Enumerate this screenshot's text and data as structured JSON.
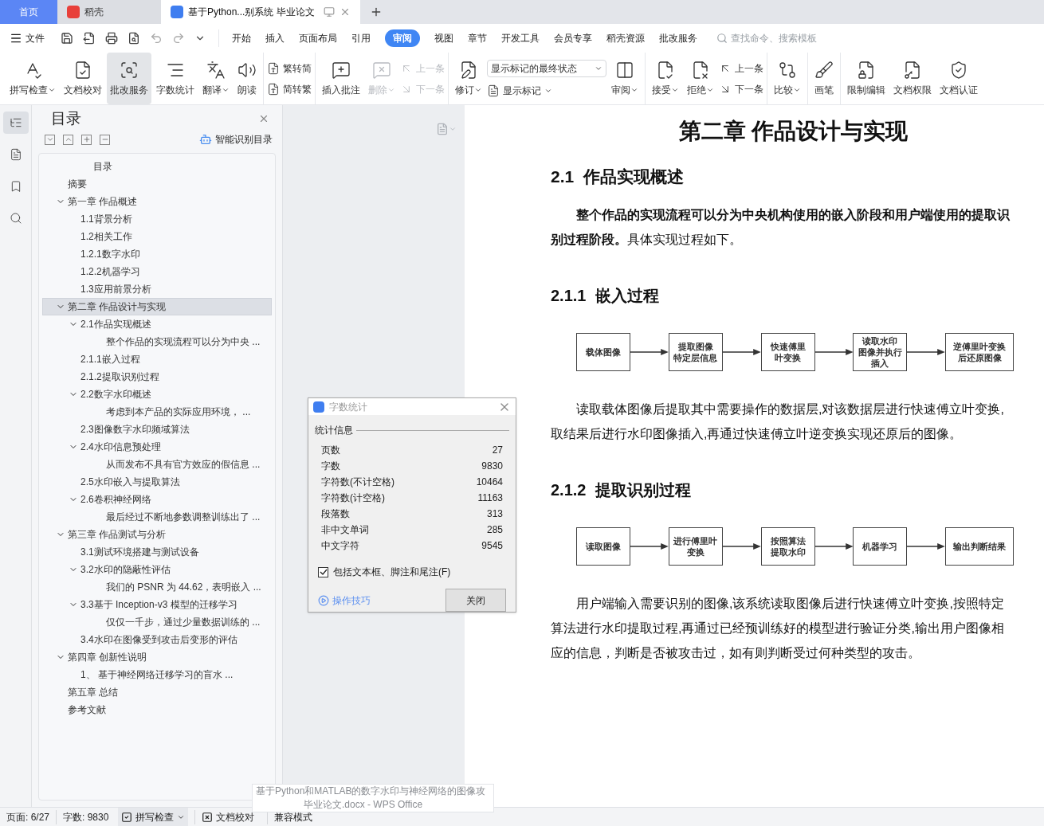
{
  "tabs": [
    {
      "label": "首页",
      "kind": "home",
      "selected": false
    },
    {
      "label": "稻壳",
      "kind": "app",
      "selected": false
    },
    {
      "label": "基于Python...别系统 毕业论文",
      "kind": "doc",
      "selected": true
    }
  ],
  "menu": {
    "file": "文件",
    "tabs": [
      {
        "label": "开始",
        "selected": false
      },
      {
        "label": "插入",
        "selected": false
      },
      {
        "label": "页面布局",
        "selected": false
      },
      {
        "label": "引用",
        "selected": false
      },
      {
        "label": "审阅",
        "selected": true
      },
      {
        "label": "视图",
        "selected": false
      },
      {
        "label": "章节",
        "selected": false
      },
      {
        "label": "开发工具",
        "selected": false
      },
      {
        "label": "会员专享",
        "selected": false
      },
      {
        "label": "稻壳资源",
        "selected": false
      },
      {
        "label": "批改服务",
        "selected": false
      }
    ],
    "search": {
      "placeholder": "查找命令、搜索模板"
    }
  },
  "ribbon": [
    {
      "items": [
        {
          "kind": "large",
          "label": "拼写检查",
          "dropdown": true,
          "disabled": false,
          "highlighted": false
        },
        {
          "kind": "large",
          "label": "文档校对",
          "dropdown": false,
          "disabled": false,
          "highlighted": false
        },
        {
          "kind": "large",
          "label": "批改服务",
          "dropdown": false,
          "disabled": false,
          "highlighted": true
        },
        {
          "kind": "large",
          "label": "字数统计",
          "dropdown": false,
          "disabled": false,
          "highlighted": false
        },
        {
          "kind": "large",
          "label": "翻译",
          "dropdown": true,
          "disabled": false,
          "highlighted": false
        },
        {
          "kind": "large",
          "label": "朗读",
          "dropdown": false,
          "disabled": false,
          "highlighted": false
        }
      ]
    },
    {
      "items": [
        {
          "kind": "stack",
          "items": [
            {
              "kind": "small",
              "label": "繁转简",
              "dropdown": false,
              "disabled": false
            },
            {
              "kind": "small",
              "label": "简转繁",
              "dropdown": false,
              "disabled": false
            }
          ]
        }
      ]
    },
    {
      "items": [
        {
          "kind": "large",
          "label": "插入批注",
          "dropdown": false,
          "disabled": false,
          "highlighted": false
        },
        {
          "kind": "large",
          "label": "删除",
          "dropdown": true,
          "disabled": true,
          "highlighted": false
        },
        {
          "kind": "stack",
          "items": [
            {
              "kind": "small",
              "label": "上一条",
              "dropdown": false,
              "disabled": true
            },
            {
              "kind": "small",
              "label": "下一条",
              "dropdown": false,
              "disabled": true
            }
          ]
        }
      ]
    },
    {
      "items": [
        {
          "kind": "large",
          "label": "修订",
          "dropdown": true,
          "disabled": false,
          "highlighted": false
        },
        {
          "kind": "stack",
          "items": [
            {
              "kind": "select",
              "value": "显示标记的最终状态"
            },
            {
              "kind": "small",
              "label": "显示标记",
              "dropdown": true,
              "disabled": false
            }
          ]
        },
        {
          "kind": "large",
          "label": "审阅",
          "dropdown": true,
          "disabled": false,
          "highlighted": false
        }
      ]
    },
    {
      "items": [
        {
          "kind": "large",
          "label": "接受",
          "dropdown": true,
          "disabled": false,
          "highlighted": false
        },
        {
          "kind": "large",
          "label": "拒绝",
          "dropdown": true,
          "disabled": false,
          "highlighted": false
        },
        {
          "kind": "stack",
          "items": [
            {
              "kind": "small",
              "label": "上一条",
              "dropdown": false,
              "disabled": false
            },
            {
              "kind": "small",
              "label": "下一条",
              "dropdown": false,
              "disabled": false
            }
          ]
        }
      ]
    },
    {
      "items": [
        {
          "kind": "large",
          "label": "比较",
          "dropdown": true,
          "disabled": false,
          "highlighted": false
        }
      ]
    },
    {
      "items": [
        {
          "kind": "large",
          "label": "画笔",
          "dropdown": false,
          "disabled": false,
          "highlighted": false
        }
      ]
    },
    {
      "items": [
        {
          "kind": "large",
          "label": "限制编辑",
          "dropdown": false,
          "disabled": false,
          "highlighted": false
        },
        {
          "kind": "large",
          "label": "文档权限",
          "dropdown": false,
          "disabled": false,
          "highlighted": false
        },
        {
          "kind": "large",
          "label": "文档认证",
          "dropdown": false,
          "disabled": false,
          "highlighted": false
        }
      ]
    }
  ],
  "rail": [
    {
      "selected": true
    },
    {
      "selected": false
    },
    {
      "selected": false
    },
    {
      "selected": false
    }
  ],
  "outline": {
    "title": "目录",
    "smart": "智能识别目录",
    "items": [
      {
        "label": "目录",
        "kind": "toc",
        "selected": false
      },
      {
        "label": "摘要",
        "selected": false
      },
      {
        "label": "第一章 作品概述",
        "expanded": true,
        "selected": false,
        "children": [
          {
            "label": "1.1背景分析",
            "selected": false
          },
          {
            "label": "1.2相关工作",
            "selected": false
          },
          {
            "label": "1.2.1数字水印",
            "selected": false
          },
          {
            "label": "1.2.2机器学习",
            "selected": false
          },
          {
            "label": "1.3应用前景分析",
            "selected": false
          }
        ]
      },
      {
        "label": "第二章 作品设计与实现",
        "expanded": true,
        "selected": true,
        "children": [
          {
            "label": "2.1作品实现概述",
            "expanded": true,
            "selected": false,
            "children": [
              {
                "label": "整个作品的实现流程可以分为中央 ...",
                "selected": false
              }
            ]
          },
          {
            "label": "2.1.1嵌入过程",
            "selected": false
          },
          {
            "label": "2.1.2提取识别过程",
            "selected": false
          },
          {
            "label": "2.2数字水印概述",
            "expanded": true,
            "selected": false,
            "children": [
              {
                "label": "考虑到本产品的实际应用环境， ...",
                "selected": false
              }
            ]
          },
          {
            "label": "2.3图像数字水印频域算法",
            "selected": false
          },
          {
            "label": "2.4水印信息预处理",
            "expanded": true,
            "selected": false,
            "children": [
              {
                "label": "从而发布不具有官方效应的假信息 ...",
                "selected": false
              }
            ]
          },
          {
            "label": "2.5水印嵌入与提取算法",
            "selected": false
          },
          {
            "label": "2.6卷积神经网络",
            "expanded": true,
            "selected": false,
            "children": [
              {
                "label": "最后经过不断地参数调整训练出了 ...",
                "selected": false
              }
            ]
          }
        ]
      },
      {
        "label": "第三章 作品测试与分析",
        "expanded": true,
        "selected": false,
        "children": [
          {
            "label": "3.1测试环境搭建与测试设备",
            "selected": false
          },
          {
            "label": "3.2水印的隐蔽性评估",
            "expanded": true,
            "selected": false,
            "children": [
              {
                "label": "我们的 PSNR 为 44.62，表明嵌入 ...",
                "selected": false
              }
            ]
          },
          {
            "label": "3.3基于 Inception-v3 模型的迁移学习",
            "expanded": true,
            "selected": false,
            "children": [
              {
                "label": "仅仅一千步，通过少量数据训练的 ...",
                "selected": false
              }
            ]
          },
          {
            "label": "3.4水印在图像受到攻击后变形的评估",
            "selected": false
          }
        ]
      },
      {
        "label": "第四章 创新性说明",
        "expanded": true,
        "selected": false,
        "children": [
          {
            "label": "1、 基于神经网络迁移学习的盲水 ...",
            "selected": false
          }
        ]
      },
      {
        "label": "第五章 总结",
        "selected": false
      },
      {
        "label": "参考文献",
        "selected": false
      }
    ]
  },
  "document": {
    "blocks": [
      {
        "kind": "title",
        "text": "第二章 作品设计与实现"
      },
      {
        "kind": "h2",
        "number": "2.1",
        "text": "作品实现概述"
      },
      {
        "kind": "para",
        "text": "**整个作品的实现流程可以分为中央机构使用的嵌入阶段和用户端使用的提取识别过程阶段。**具体实现过程如下。"
      },
      {
        "kind": "h3",
        "number": "2.1.1",
        "text": "嵌入过程"
      },
      {
        "kind": "flow",
        "steps": [
          [
            "载体图像"
          ],
          [
            "提取图像",
            "特定层信息"
          ],
          [
            "快速傅里",
            "叶变换"
          ],
          [
            "读取水印",
            "图像并执行",
            "插入"
          ],
          [
            "逆傅里叶变换",
            "后还原图像"
          ]
        ]
      },
      {
        "kind": "para",
        "text": "读取载体图像后提取其中需要操作的数据层,对该数据层进行快速傅立叶变换,取结果后进行水印图像插入,再通过快速傅立叶逆变换实现还原后的图像。"
      },
      {
        "kind": "h3",
        "number": "2.1.2",
        "text": "提取识别过程"
      },
      {
        "kind": "flow",
        "steps": [
          [
            "读取图像"
          ],
          [
            "进行傅里叶",
            "变换"
          ],
          [
            "按照算法",
            "提取水印"
          ],
          [
            "机器学习"
          ],
          [
            "输出判断结果"
          ]
        ]
      },
      {
        "kind": "para",
        "text": "用户端输入需要识别的图像,该系统读取图像后进行快速傅立叶变换,按照特定算法进行水印提取过程,再通过已经预训练好的模型进行验证分类,输出用户图像相应的信息，判断是否被攻击过，如有则判断受过何种类型的攻击。"
      }
    ]
  },
  "dialog": {
    "title": "字数统计",
    "group": "统计信息",
    "rows": [
      {
        "label": "页数",
        "value": "27"
      },
      {
        "label": "字数",
        "value": "9830"
      },
      {
        "label": "字符数(不计空格)",
        "value": "10464"
      },
      {
        "label": "字符数(计空格)",
        "value": "11163"
      },
      {
        "label": "段落数",
        "value": "313"
      },
      {
        "label": "非中文单词",
        "value": "285"
      },
      {
        "label": "中文字符",
        "value": "9545"
      }
    ],
    "checkbox": {
      "label": "包括文本框、脚注和尾注(F)",
      "checked": true
    },
    "link": "操作技巧",
    "button": "关闭"
  },
  "status_bar": {
    "page": "页面: 6/27",
    "words": "字数: 9830",
    "spell": "拼写检查",
    "proof": "文档校对",
    "mode": "兼容模式"
  },
  "tooltip": [
    "基于Python和MATLAB的数字水印与神经网络的图像攻",
    "毕业论文.docx - WPS Office"
  ]
}
